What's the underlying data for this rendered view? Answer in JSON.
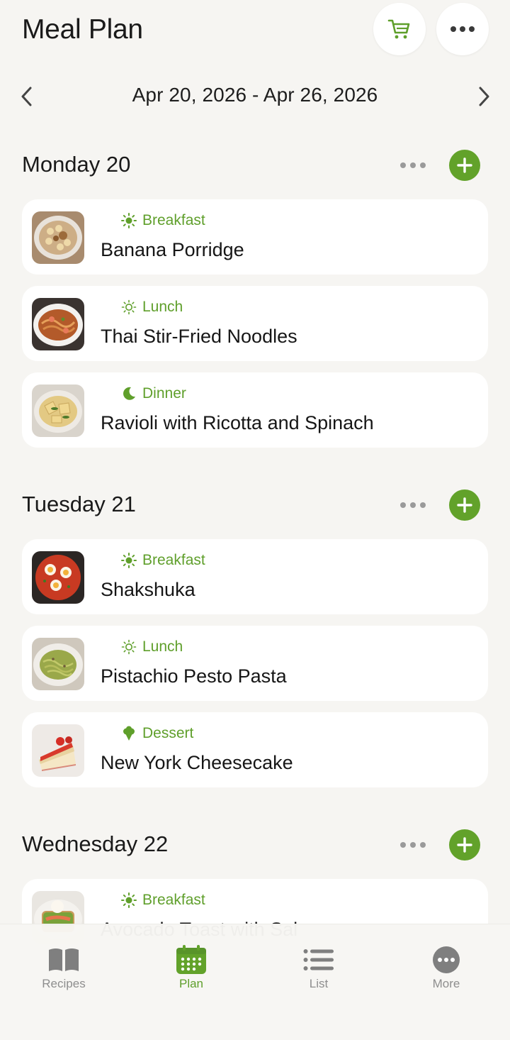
{
  "header": {
    "title": "Meal Plan",
    "cart_icon": "cart-icon",
    "more_icon": "ellipsis-icon",
    "date_range": "Apr 20, 2026 - Apr 26, 2026"
  },
  "colors": {
    "accent": "#62a22a",
    "background": "#f6f5f2",
    "card": "#ffffff"
  },
  "days": [
    {
      "title": "Monday 20",
      "meals": [
        {
          "type": "Breakfast",
          "icon": "sun-icon",
          "name": "Banana Porridge",
          "thumb": "porridge"
        },
        {
          "type": "Lunch",
          "icon": "sun-outline-icon",
          "name": "Thai Stir-Fried Noodles",
          "thumb": "noodles"
        },
        {
          "type": "Dinner",
          "icon": "moon-icon",
          "name": "Ravioli with Ricotta and Spinach",
          "thumb": "ravioli"
        }
      ]
    },
    {
      "title": "Tuesday 21",
      "meals": [
        {
          "type": "Breakfast",
          "icon": "sun-icon",
          "name": "Shakshuka",
          "thumb": "shakshuka"
        },
        {
          "type": "Lunch",
          "icon": "sun-outline-icon",
          "name": "Pistachio Pesto Pasta",
          "thumb": "pesto"
        },
        {
          "type": "Dessert",
          "icon": "ice-cream-icon",
          "name": "New York Cheesecake",
          "thumb": "cheesecake"
        }
      ]
    },
    {
      "title": "Wednesday 22",
      "meals": [
        {
          "type": "Breakfast",
          "icon": "sun-icon",
          "name": "Avocado Toast with Sal",
          "thumb": "avocado"
        }
      ]
    }
  ],
  "tabs": [
    {
      "label": "Recipes",
      "icon": "book-icon",
      "active": false
    },
    {
      "label": "Plan",
      "icon": "calendar-icon",
      "active": true
    },
    {
      "label": "List",
      "icon": "list-icon",
      "active": false
    },
    {
      "label": "More",
      "icon": "more-circle-icon",
      "active": false
    }
  ]
}
